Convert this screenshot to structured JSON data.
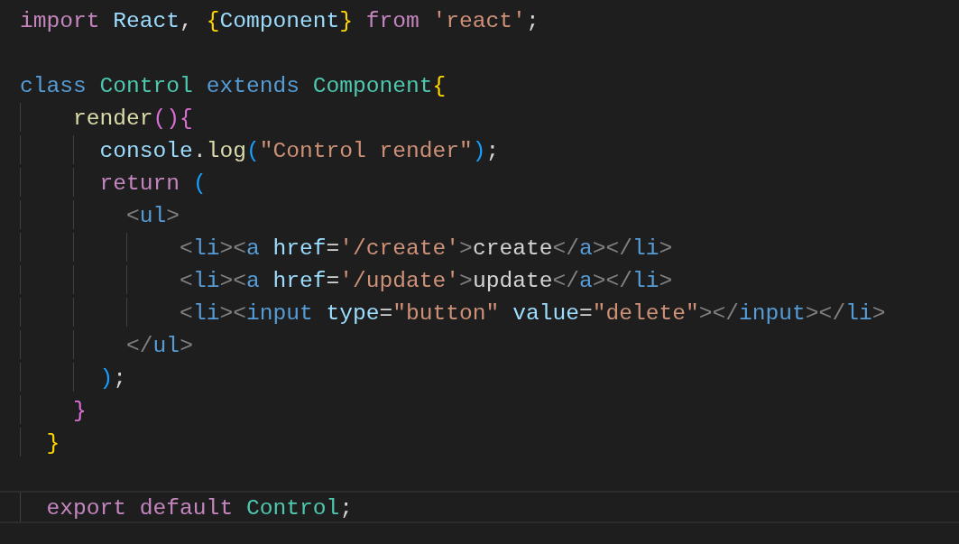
{
  "editor": {
    "lines": [
      {
        "current": false,
        "tokens": [
          {
            "text": "import ",
            "kind": "keyword"
          },
          {
            "text": "React",
            "kind": "variable"
          },
          {
            "text": ", ",
            "kind": "plain"
          },
          {
            "text": "{",
            "kind": "bracket1"
          },
          {
            "text": "Component",
            "kind": "variable"
          },
          {
            "text": "} ",
            "kind": "bracket1"
          },
          {
            "text": "from ",
            "kind": "keyword"
          },
          {
            "text": "'react'",
            "kind": "string"
          },
          {
            "text": ";",
            "kind": "plain"
          }
        ]
      },
      {
        "current": false
      },
      {
        "current": false,
        "tokens": [
          {
            "text": "class ",
            "kind": "storage"
          },
          {
            "text": "Control ",
            "kind": "type"
          },
          {
            "text": "extends ",
            "kind": "storage"
          },
          {
            "text": "Component",
            "kind": "type"
          },
          {
            "text": "{",
            "kind": "bracket1"
          }
        ]
      },
      {
        "current": false,
        "tokens": [
          {
            "text": "    render",
            "kind": "function"
          },
          {
            "text": "(){",
            "kind": "bracket2"
          }
        ]
      },
      {
        "current": false,
        "tokens": [
          {
            "text": "      console",
            "kind": "variable"
          },
          {
            "text": ".",
            "kind": "plain"
          },
          {
            "text": "log",
            "kind": "function"
          },
          {
            "text": "(",
            "kind": "bracket3"
          },
          {
            "text": "\"Control render\"",
            "kind": "string"
          },
          {
            "text": ")",
            "kind": "bracket3"
          },
          {
            "text": ";",
            "kind": "plain"
          }
        ]
      },
      {
        "current": false,
        "tokens": [
          {
            "text": "      return ",
            "kind": "keyword"
          },
          {
            "text": "(",
            "kind": "bracket3"
          }
        ]
      },
      {
        "current": false,
        "tokens": [
          {
            "text": "        <",
            "kind": "punct"
          },
          {
            "text": "ul",
            "kind": "tag"
          },
          {
            "text": ">",
            "kind": "punct"
          }
        ]
      },
      {
        "current": false,
        "tokens": [
          {
            "text": "            <",
            "kind": "punct"
          },
          {
            "text": "li",
            "kind": "tag"
          },
          {
            "text": "><",
            "kind": "punct"
          },
          {
            "text": "a ",
            "kind": "tag"
          },
          {
            "text": "href",
            "kind": "attr"
          },
          {
            "text": "=",
            "kind": "plain"
          },
          {
            "text": "'/create'",
            "kind": "string"
          },
          {
            "text": ">",
            "kind": "punct"
          },
          {
            "text": "create",
            "kind": "plain"
          },
          {
            "text": "</",
            "kind": "punct"
          },
          {
            "text": "a",
            "kind": "tag"
          },
          {
            "text": "></",
            "kind": "punct"
          },
          {
            "text": "li",
            "kind": "tag"
          },
          {
            "text": ">",
            "kind": "punct"
          }
        ]
      },
      {
        "current": false,
        "tokens": [
          {
            "text": "            <",
            "kind": "punct"
          },
          {
            "text": "li",
            "kind": "tag"
          },
          {
            "text": "><",
            "kind": "punct"
          },
          {
            "text": "a ",
            "kind": "tag"
          },
          {
            "text": "href",
            "kind": "attr"
          },
          {
            "text": "=",
            "kind": "plain"
          },
          {
            "text": "'/update'",
            "kind": "string"
          },
          {
            "text": ">",
            "kind": "punct"
          },
          {
            "text": "update",
            "kind": "plain"
          },
          {
            "text": "</",
            "kind": "punct"
          },
          {
            "text": "a",
            "kind": "tag"
          },
          {
            "text": "></",
            "kind": "punct"
          },
          {
            "text": "li",
            "kind": "tag"
          },
          {
            "text": ">",
            "kind": "punct"
          }
        ]
      },
      {
        "current": false,
        "tokens": [
          {
            "text": "            <",
            "kind": "punct"
          },
          {
            "text": "li",
            "kind": "tag"
          },
          {
            "text": "><",
            "kind": "punct"
          },
          {
            "text": "input ",
            "kind": "tag"
          },
          {
            "text": "type",
            "kind": "attr"
          },
          {
            "text": "=",
            "kind": "plain"
          },
          {
            "text": "\"button\" ",
            "kind": "string"
          },
          {
            "text": "value",
            "kind": "attr"
          },
          {
            "text": "=",
            "kind": "plain"
          },
          {
            "text": "\"delete\"",
            "kind": "string"
          },
          {
            "text": "></",
            "kind": "punct"
          },
          {
            "text": "input",
            "kind": "tag"
          },
          {
            "text": "></",
            "kind": "punct"
          },
          {
            "text": "li",
            "kind": "tag"
          },
          {
            "text": ">",
            "kind": "punct"
          }
        ]
      },
      {
        "current": false,
        "tokens": [
          {
            "text": "        </",
            "kind": "punct"
          },
          {
            "text": "ul",
            "kind": "tag"
          },
          {
            "text": ">",
            "kind": "punct"
          }
        ]
      },
      {
        "current": false,
        "tokens": [
          {
            "text": "      )",
            "kind": "bracket3"
          },
          {
            "text": ";",
            "kind": "plain"
          }
        ]
      },
      {
        "current": false,
        "tokens": [
          {
            "text": "    }",
            "kind": "bracket2"
          }
        ]
      },
      {
        "current": false,
        "tokens": [
          {
            "text": "  }",
            "kind": "bracket1"
          }
        ]
      },
      {
        "current": false
      },
      {
        "current": true,
        "tokens": [
          {
            "text": "  export ",
            "kind": "keyword"
          },
          {
            "text": "default ",
            "kind": "keyword"
          },
          {
            "text": "Control",
            "kind": "type"
          },
          {
            "text": ";",
            "kind": "plain"
          }
        ]
      }
    ]
  }
}
